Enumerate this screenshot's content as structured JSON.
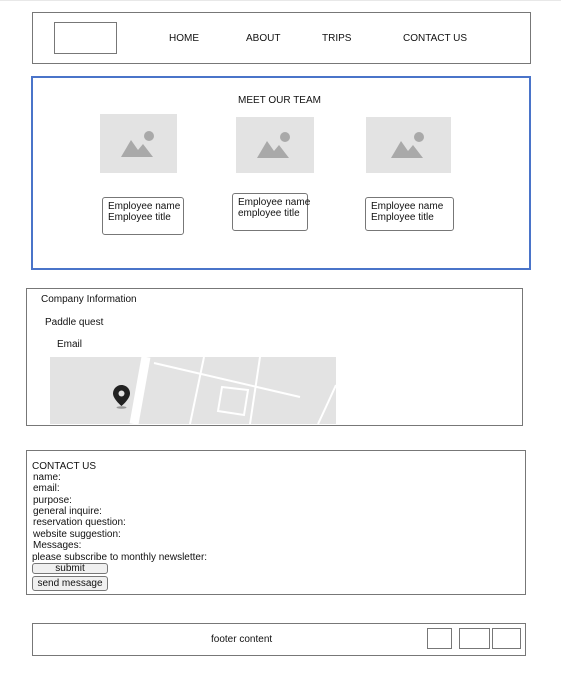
{
  "header": {
    "nav": [
      "HOME",
      "ABOUT",
      "TRIPS",
      "CONTACT US"
    ]
  },
  "team": {
    "title": "MEET OUR TEAM",
    "members": [
      {
        "name": "Employee name",
        "title": "Employee title"
      },
      {
        "name": "Employee name",
        "title": "employee title"
      },
      {
        "name": "Employee name",
        "title": "Employee title"
      }
    ]
  },
  "company": {
    "heading": "Company Information",
    "name": "Paddle quest",
    "email_label": "Email"
  },
  "contact": {
    "heading": "CONTACT US",
    "lines": [
      " name:",
      " email:",
      " purpose:",
      "general inquire:",
      "reservation question:",
      "website suggestion:",
      " Messages:",
      "please subscribe to monthly newsletter:"
    ],
    "submit_label": "submit",
    "send_label": "send message"
  },
  "footer": {
    "text": "footer content"
  },
  "colors": {
    "team_border": "#4a74c9",
    "placeholder_bg": "#e3e3e3",
    "placeholder_icon": "#a9a9a9"
  }
}
